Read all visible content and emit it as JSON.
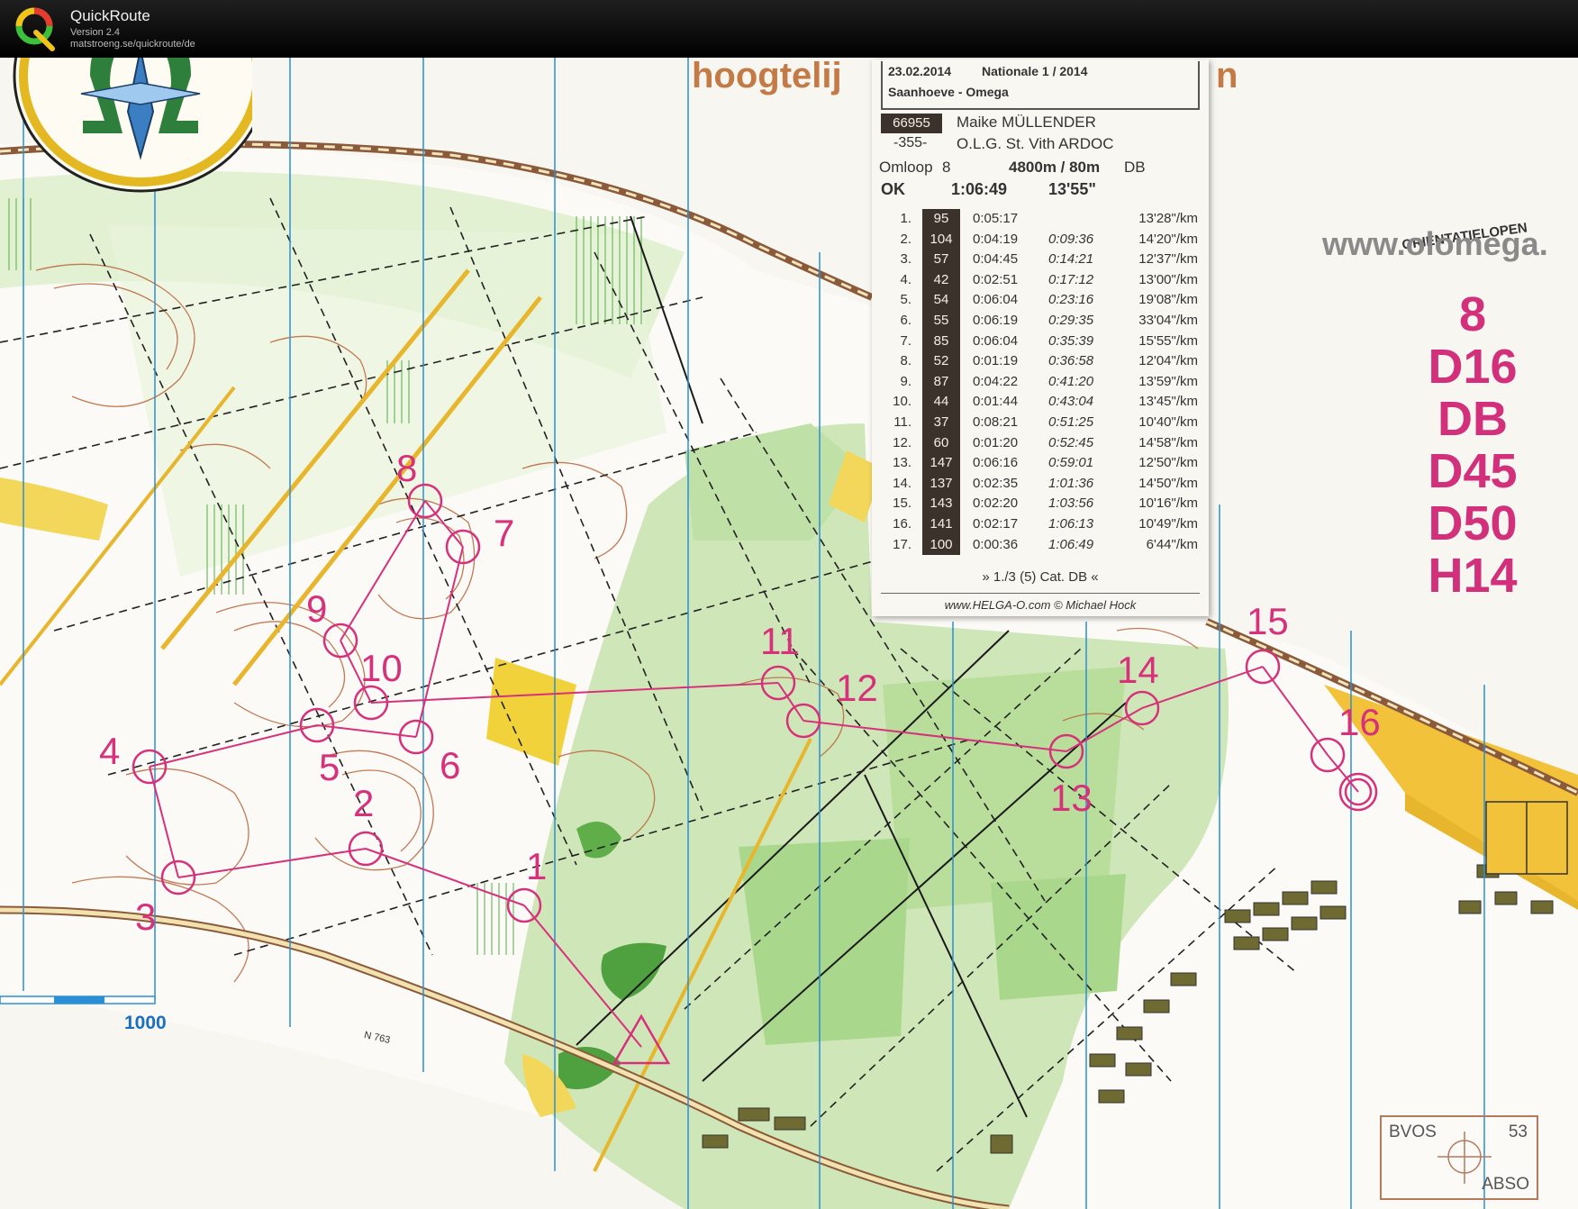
{
  "app": {
    "name": "QuickRoute",
    "version": "Version 2.4",
    "url": "matstroeng.se/quickroute/de"
  },
  "map": {
    "title_fragment": "hoogtelij",
    "title_end": "n",
    "website": "www.olomega.",
    "logo_text": "ORIENTATIELOPEN",
    "scale_label": "1000",
    "road_label": "N 763",
    "classes": [
      "8",
      "D16",
      "DB",
      "D45",
      "D50",
      "H14"
    ],
    "corner_box": {
      "left": "BVOS",
      "right": "53",
      "bottom": "ABSO"
    },
    "controls": [
      "1",
      "2",
      "3",
      "4",
      "5",
      "6",
      "7",
      "8",
      "9",
      "10",
      "11",
      "12",
      "13",
      "14",
      "15",
      "16"
    ],
    "colors": {
      "course": "#d6317a",
      "grid": "#2a8fd6",
      "open": "#f2d23a",
      "forest": "#bfe0a6",
      "dark_green": "#4fa03e",
      "contour": "#b8653a"
    }
  },
  "splits": {
    "date": "23.02.2014",
    "series": "Nationale 1 / 2014",
    "venue": "Saanhoeve - Omega",
    "chip": "66955",
    "name": "Maike MÜLLENDER",
    "number": "-355-",
    "club": "O.L.G. St. Vith ARDOC",
    "course_label": "Omloop",
    "course_number": "8",
    "course_details": "4800m / 80m",
    "course_class": "DB",
    "status": "OK",
    "total_time": "1:06:49",
    "pace": "13'55\"",
    "rows": [
      {
        "idx": "1.",
        "code": "95",
        "leg": "0:05:17",
        "cum": "",
        "pace": "13'28\"/km"
      },
      {
        "idx": "2.",
        "code": "104",
        "leg": "0:04:19",
        "cum": "0:09:36",
        "pace": "14'20\"/km"
      },
      {
        "idx": "3.",
        "code": "57",
        "leg": "0:04:45",
        "cum": "0:14:21",
        "pace": "12'37\"/km"
      },
      {
        "idx": "4.",
        "code": "42",
        "leg": "0:02:51",
        "cum": "0:17:12",
        "pace": "13'00\"/km"
      },
      {
        "idx": "5.",
        "code": "54",
        "leg": "0:06:04",
        "cum": "0:23:16",
        "pace": "19'08\"/km"
      },
      {
        "idx": "6.",
        "code": "55",
        "leg": "0:06:19",
        "cum": "0:29:35",
        "pace": "33'04\"/km"
      },
      {
        "idx": "7.",
        "code": "85",
        "leg": "0:06:04",
        "cum": "0:35:39",
        "pace": "15'55\"/km"
      },
      {
        "idx": "8.",
        "code": "52",
        "leg": "0:01:19",
        "cum": "0:36:58",
        "pace": "12'04\"/km"
      },
      {
        "idx": "9.",
        "code": "87",
        "leg": "0:04:22",
        "cum": "0:41:20",
        "pace": "13'59\"/km"
      },
      {
        "idx": "10.",
        "code": "44",
        "leg": "0:01:44",
        "cum": "0:43:04",
        "pace": "13'45\"/km"
      },
      {
        "idx": "11.",
        "code": "37",
        "leg": "0:08:21",
        "cum": "0:51:25",
        "pace": "10'40\"/km"
      },
      {
        "idx": "12.",
        "code": "60",
        "leg": "0:01:20",
        "cum": "0:52:45",
        "pace": "14'58\"/km"
      },
      {
        "idx": "13.",
        "code": "147",
        "leg": "0:06:16",
        "cum": "0:59:01",
        "pace": "12'50\"/km"
      },
      {
        "idx": "14.",
        "code": "137",
        "leg": "0:02:35",
        "cum": "1:01:36",
        "pace": "14'50\"/km"
      },
      {
        "idx": "15.",
        "code": "143",
        "leg": "0:02:20",
        "cum": "1:03:56",
        "pace": "10'16\"/km"
      },
      {
        "idx": "16.",
        "code": "141",
        "leg": "0:02:17",
        "cum": "1:06:13",
        "pace": "10'49\"/km"
      },
      {
        "idx": "17.",
        "code": "100",
        "leg": "0:00:36",
        "cum": "1:06:49",
        "pace": "6'44\"/km"
      }
    ],
    "rank": "» 1./3 (5) Cat. DB «",
    "footer": "www.HELGA-O.com © Michael Hock"
  }
}
